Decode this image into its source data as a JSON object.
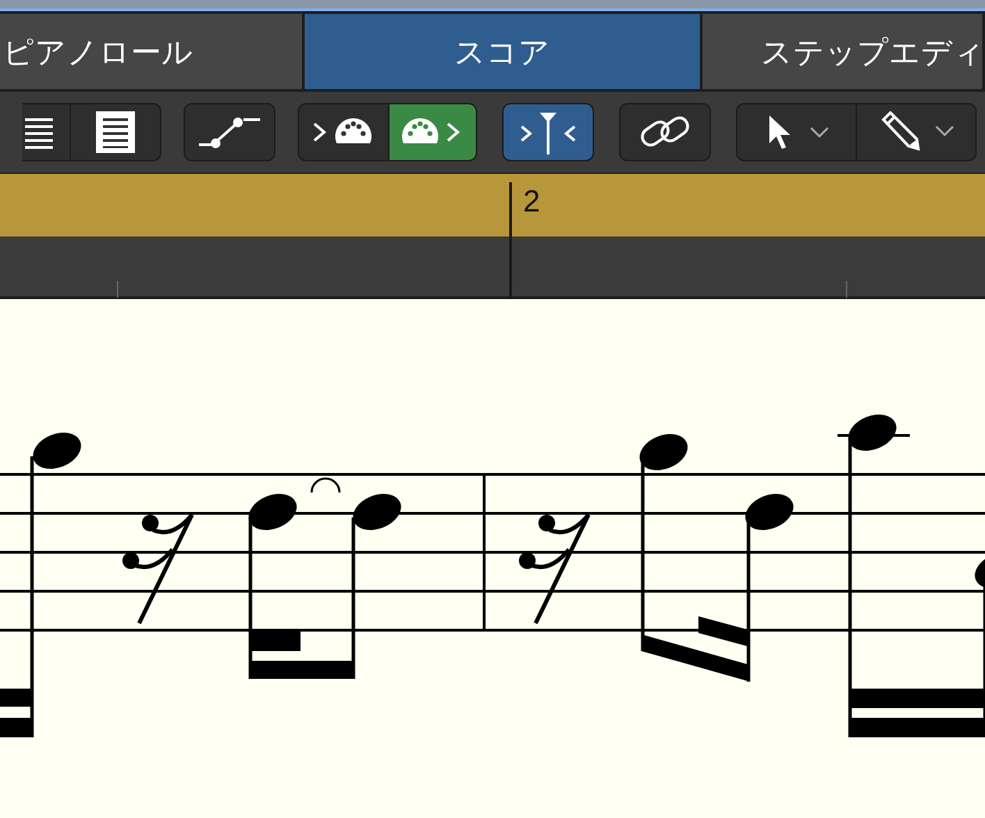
{
  "tabs": [
    {
      "label": "ピアノロール",
      "selected": false
    },
    {
      "label": "スコア",
      "selected": true
    },
    {
      "label": "ステップエディ",
      "selected": false
    }
  ],
  "toolbar": [
    {
      "buttons": [
        {
          "kind": "lines",
          "on": false
        },
        {
          "kind": "page",
          "on": false
        }
      ]
    },
    {
      "buttons": [
        {
          "kind": "curve",
          "on": false
        }
      ]
    },
    {
      "buttons": [
        {
          "kind": "midi-in",
          "on": false
        },
        {
          "kind": "midi-out",
          "on": true
        }
      ]
    },
    {
      "buttons": [
        {
          "kind": "catch",
          "on": true
        }
      ]
    },
    {
      "buttons": [
        {
          "kind": "link",
          "on": false
        }
      ]
    },
    {
      "buttons": [
        {
          "kind": "pointer",
          "on": false
        },
        {
          "kind": "pencil",
          "on": false
        }
      ]
    }
  ],
  "ruler": {
    "bar_number": "2"
  }
}
